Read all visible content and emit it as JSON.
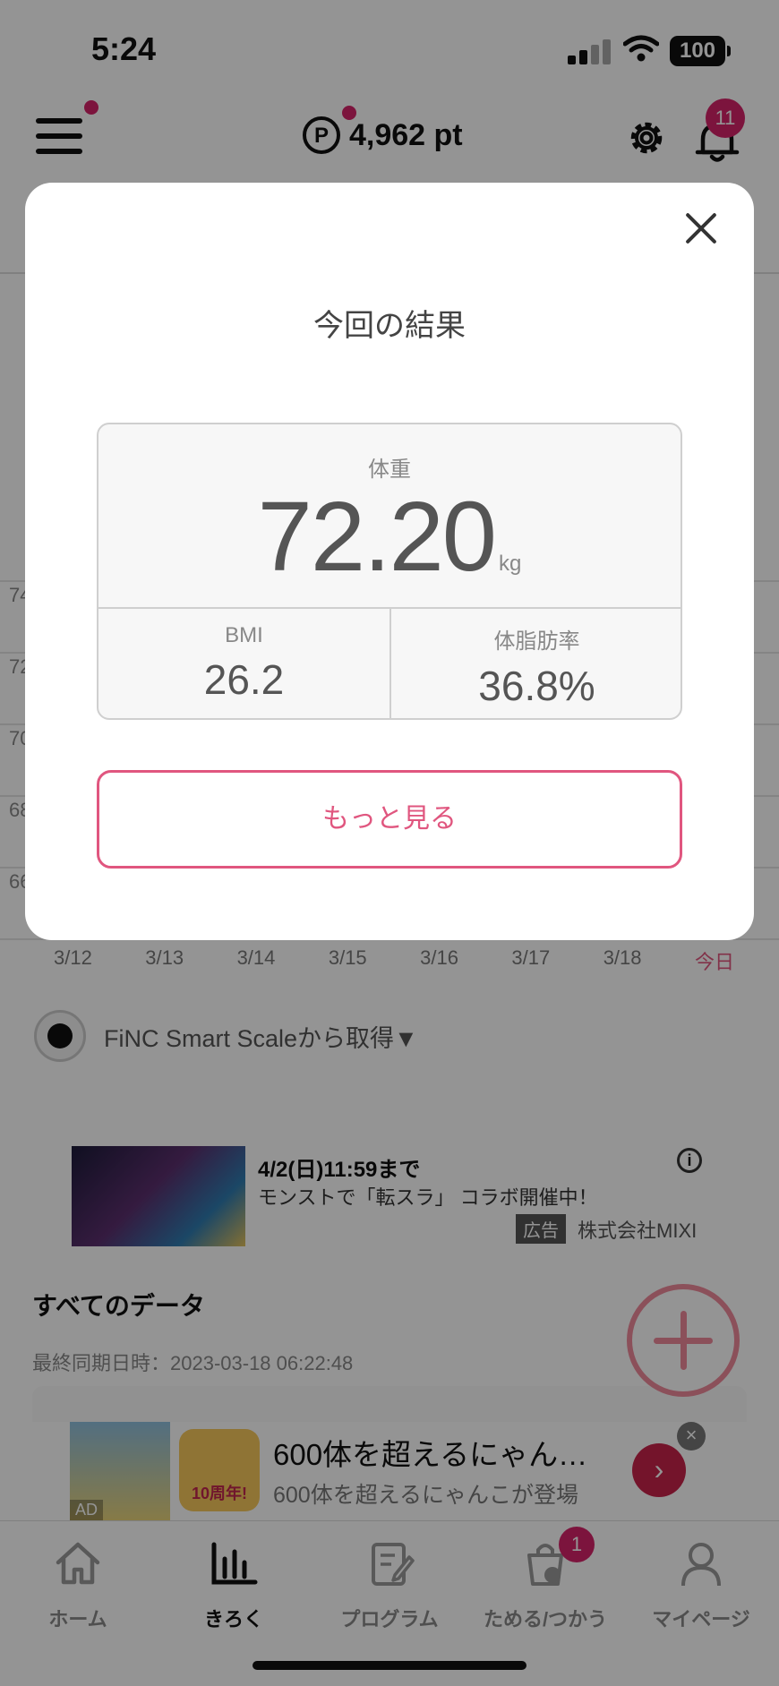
{
  "status_bar": {
    "time": "5:24",
    "battery": "100"
  },
  "header": {
    "points": "4,962 pt",
    "points_symbol": "P",
    "notification_count": "11"
  },
  "chart": {
    "y_ticks": [
      "74",
      "72",
      "70",
      "68",
      "66"
    ],
    "dates": [
      "3/12",
      "3/13",
      "3/14",
      "3/15",
      "3/16",
      "3/17",
      "3/18",
      "今日"
    ]
  },
  "source": {
    "text": "FiNC Smart Scaleから取得▼"
  },
  "ad": {
    "deadline": "4/2(日)11:59まで",
    "description": "モンストで「転スラ」 コラボ開催中！",
    "label": "広告",
    "company": "株式会社MIXI"
  },
  "all_data": {
    "title": "すべてのデータ",
    "last_sync": "最終同期日時：2023-03-18 06:22:48"
  },
  "banner": {
    "title": "600体を超えるにゃん…",
    "subtitle": "600体を超えるにゃんこが登場",
    "ad_tag": "AD",
    "logo_text": "10周年!"
  },
  "tabs": [
    {
      "label": "ホーム",
      "icon": "home-icon"
    },
    {
      "label": "きろく",
      "icon": "bar-chart-icon"
    },
    {
      "label": "プログラム",
      "icon": "notebook-icon"
    },
    {
      "label": "ためる/つかう",
      "icon": "bag-icon",
      "badge": "1"
    },
    {
      "label": "マイページ",
      "icon": "person-icon"
    }
  ],
  "modal": {
    "title": "今回の結果",
    "weight_label": "体重",
    "weight_value": "72.20",
    "weight_unit": "kg",
    "bmi_label": "BMI",
    "bmi_value": "26.2",
    "body_fat_label": "体脂肪率",
    "body_fat_value": "36.8%",
    "more_button": "もっと見る"
  },
  "colors": {
    "accent": "#e0567f",
    "badge": "#d6246a",
    "fab": "#ef8a9b"
  }
}
